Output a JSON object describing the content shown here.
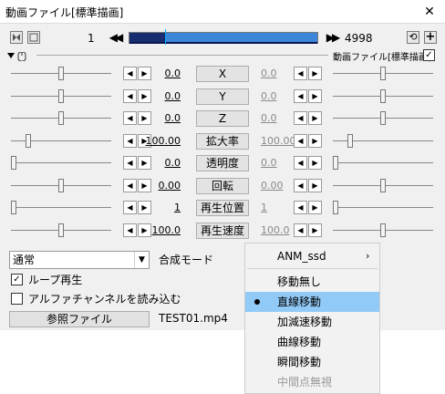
{
  "window": {
    "title": "動画ファイル[標準描画]",
    "close_glyph": "✕"
  },
  "toolbar": {
    "frame_current": "1",
    "frame_end": "4998",
    "prev_glyph": "◀◀",
    "next_glyph": "▶▶",
    "plus_glyph": "+",
    "refresh_glyph": "⟲",
    "playhead_fraction": 0.19,
    "object_label": "動画ファイル[標準描画]",
    "object_checked": "✓"
  },
  "params": [
    {
      "name": "X",
      "start": "0.0",
      "end": "0.0",
      "left_slider": 0.5,
      "right_slider": 0.5
    },
    {
      "name": "Y",
      "start": "0.0",
      "end": "0.0",
      "left_slider": 0.5,
      "right_slider": 0.5
    },
    {
      "name": "Z",
      "start": "0.0",
      "end": "0.0",
      "left_slider": 0.5,
      "right_slider": 0.5
    },
    {
      "name": "拡大率",
      "start": "100.00",
      "end": "100.00",
      "left_slider": 0.17,
      "right_slider": 0.17
    },
    {
      "name": "透明度",
      "start": "0.0",
      "end": "0.0",
      "left_slider": 0.03,
      "right_slider": 0.03
    },
    {
      "name": "回転",
      "start": "0.00",
      "end": "0.00",
      "left_slider": 0.5,
      "right_slider": 0.5
    },
    {
      "name": "再生位置",
      "start": "1",
      "end": "1",
      "left_slider": 0.03,
      "right_slider": 0.03
    },
    {
      "name": "再生速度",
      "start": "100.0",
      "end": "100.0",
      "left_slider": 0.5,
      "right_slider": 0.5
    }
  ],
  "spin_left": "◀",
  "spin_right": "▶",
  "blend": {
    "value": "通常",
    "arrow": "▼",
    "label": "合成モード"
  },
  "options": [
    {
      "label": "ループ再生",
      "checked": "✓"
    },
    {
      "label": "アルファチャンネルを読み込む",
      "checked": ""
    }
  ],
  "reference": {
    "button_label": "参照ファイル",
    "filename": "TEST01.mp4"
  },
  "context_menu": {
    "items": [
      {
        "label": "ANM_ssd",
        "submenu": "›"
      },
      {
        "label": "移動無し"
      },
      {
        "label": "直線移動"
      },
      {
        "label": "加減速移動"
      },
      {
        "label": "曲線移動"
      },
      {
        "label": "瞬間移動"
      },
      {
        "label": "中間点無視"
      }
    ]
  },
  "colors": {
    "timeline_fill": "#3b86d8",
    "timeline_played": "#172d70",
    "menu_highlight": "#91c9f7"
  }
}
